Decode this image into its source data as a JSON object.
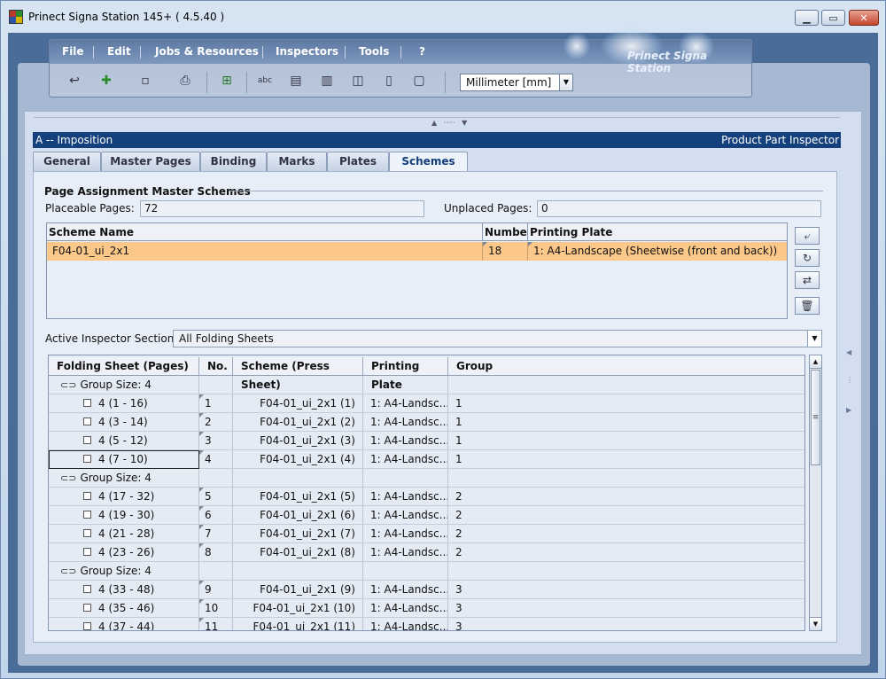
{
  "window": {
    "title": "Prinect Signa Station 145+  ( 4.5.40 )"
  },
  "menu": {
    "items": [
      "File",
      "Edit",
      "Jobs & Resources",
      "Inspectors",
      "Tools",
      "?"
    ],
    "brand": "Prinect Signa Station"
  },
  "toolbar": {
    "unit": "Millimeter  [mm]"
  },
  "header": {
    "left": "A -- Imposition",
    "right": "Product Part Inspector"
  },
  "tabs": [
    "General",
    "Master Pages",
    "Binding",
    "Marks",
    "Plates",
    "Schemes"
  ],
  "active_tab": "Schemes",
  "page_assignment": {
    "title": "Page Assignment  Master Schemes",
    "placeable_label": "Placeable Pages:",
    "placeable_value": "72",
    "unplaced_label": "Unplaced Pages:",
    "unplaced_value": "0"
  },
  "schemes_table": {
    "headers": [
      "Scheme Name",
      "Number",
      "Printing Plate"
    ],
    "rows": [
      {
        "name": "F04-01_ui_2x1",
        "number": "18",
        "plate": "1: A4-Landscape (Sheetwise (front and back))"
      }
    ]
  },
  "active_section": {
    "label": "Active Inspector Section:",
    "value": "All Folding Sheets"
  },
  "folding_table": {
    "headers": [
      "Folding Sheet (Pages)",
      "No.",
      "Scheme (Press Sheet)",
      "Printing Plate",
      "Group"
    ],
    "rows": [
      {
        "type": "group",
        "label": "Group Size: 4"
      },
      {
        "type": "sheet",
        "pages": "4 (1 - 16)",
        "no": "1",
        "scheme": "F04-01_ui_2x1  (1)",
        "plate": "1: A4-Landsc...",
        "group": "1"
      },
      {
        "type": "sheet",
        "pages": "4 (3 - 14)",
        "no": "2",
        "scheme": "F04-01_ui_2x1  (2)",
        "plate": "1: A4-Landsc...",
        "group": "1"
      },
      {
        "type": "sheet",
        "pages": "4 (5 - 12)",
        "no": "3",
        "scheme": "F04-01_ui_2x1  (3)",
        "plate": "1: A4-Landsc...",
        "group": "1"
      },
      {
        "type": "sheet",
        "pages": "4 (7 - 10)",
        "no": "4",
        "scheme": "F04-01_ui_2x1  (4)",
        "plate": "1: A4-Landsc...",
        "group": "1",
        "selected": true
      },
      {
        "type": "group",
        "label": "Group Size: 4"
      },
      {
        "type": "sheet",
        "pages": "4 (17 - 32)",
        "no": "5",
        "scheme": "F04-01_ui_2x1  (5)",
        "plate": "1: A4-Landsc...",
        "group": "2"
      },
      {
        "type": "sheet",
        "pages": "4 (19 - 30)",
        "no": "6",
        "scheme": "F04-01_ui_2x1  (6)",
        "plate": "1: A4-Landsc...",
        "group": "2"
      },
      {
        "type": "sheet",
        "pages": "4 (21 - 28)",
        "no": "7",
        "scheme": "F04-01_ui_2x1  (7)",
        "plate": "1: A4-Landsc...",
        "group": "2"
      },
      {
        "type": "sheet",
        "pages": "4 (23 - 26)",
        "no": "8",
        "scheme": "F04-01_ui_2x1  (8)",
        "plate": "1: A4-Landsc...",
        "group": "2"
      },
      {
        "type": "group",
        "label": "Group Size: 4"
      },
      {
        "type": "sheet",
        "pages": "4 (33 - 48)",
        "no": "9",
        "scheme": "F04-01_ui_2x1  (9)",
        "plate": "1: A4-Landsc...",
        "group": "3"
      },
      {
        "type": "sheet",
        "pages": "4 (35 - 46)",
        "no": "10",
        "scheme": "F04-01_ui_2x1  (10)",
        "plate": "1: A4-Landsc...",
        "group": "3"
      },
      {
        "type": "sheet",
        "pages": "4 (37 - 44)",
        "no": "11",
        "scheme": "F04-01_ui_2x1  (11)",
        "plate": "1: A4-Landsc...",
        "group": "3"
      }
    ]
  }
}
